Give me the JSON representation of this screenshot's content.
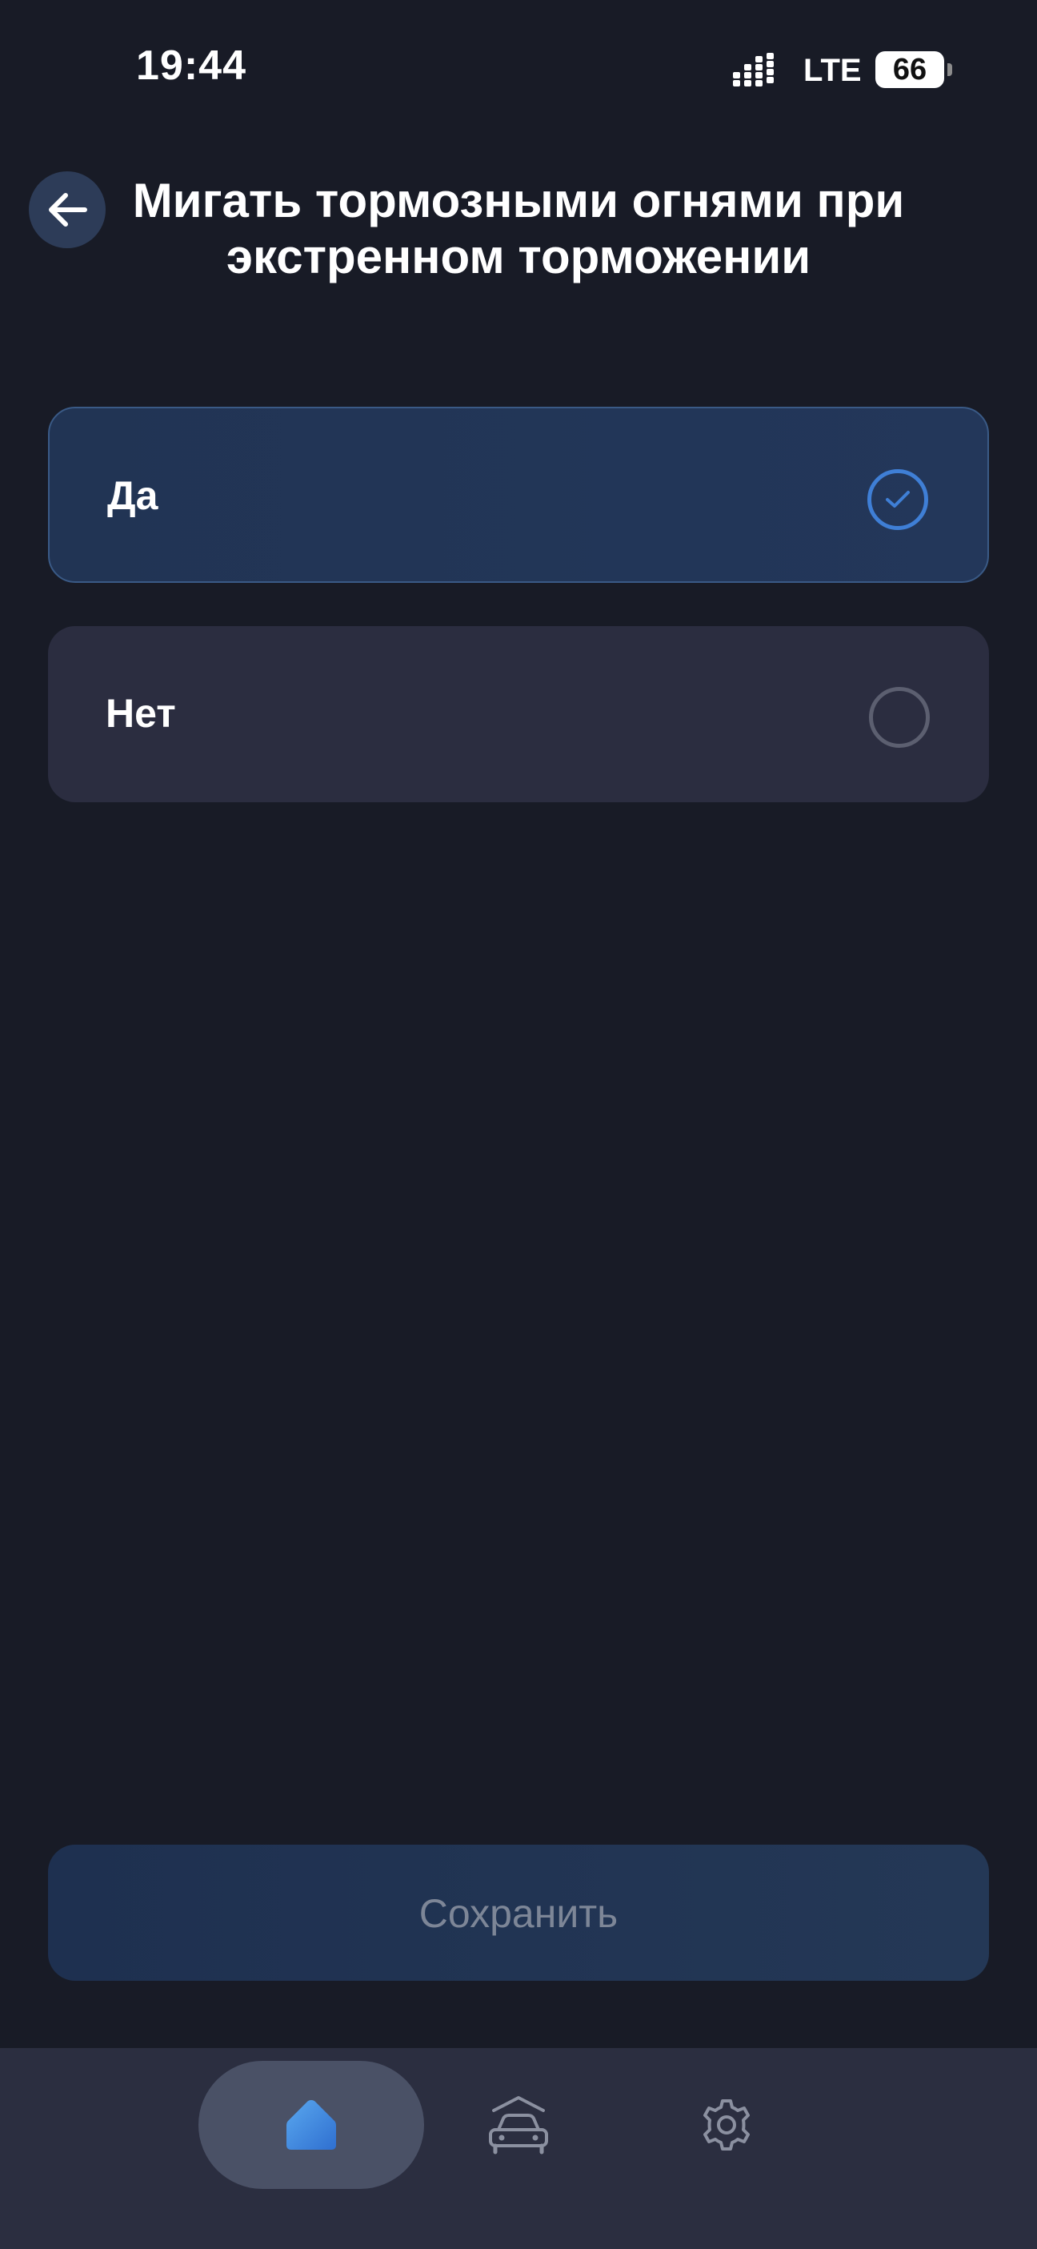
{
  "status_bar": {
    "time": "19:44",
    "network": "LTE",
    "battery": "66"
  },
  "header": {
    "title": "Мигать тормозными огнями при экстренном торможении",
    "back_icon": "arrow-left-icon"
  },
  "options": [
    {
      "label": "Да",
      "selected": true
    },
    {
      "label": "Нет",
      "selected": false
    }
  ],
  "save_button": {
    "label": "Сохранить"
  },
  "bottom_nav": {
    "items": [
      {
        "icon": "home-icon",
        "active": true
      },
      {
        "icon": "car-icon",
        "active": false
      },
      {
        "icon": "gear-icon",
        "active": false
      }
    ]
  },
  "colors": {
    "background": "#181b26",
    "accent": "#3f7fd6",
    "selected_card": "#213454",
    "unselected_card": "#2b2d40",
    "nav_bar": "#2b2e40"
  }
}
